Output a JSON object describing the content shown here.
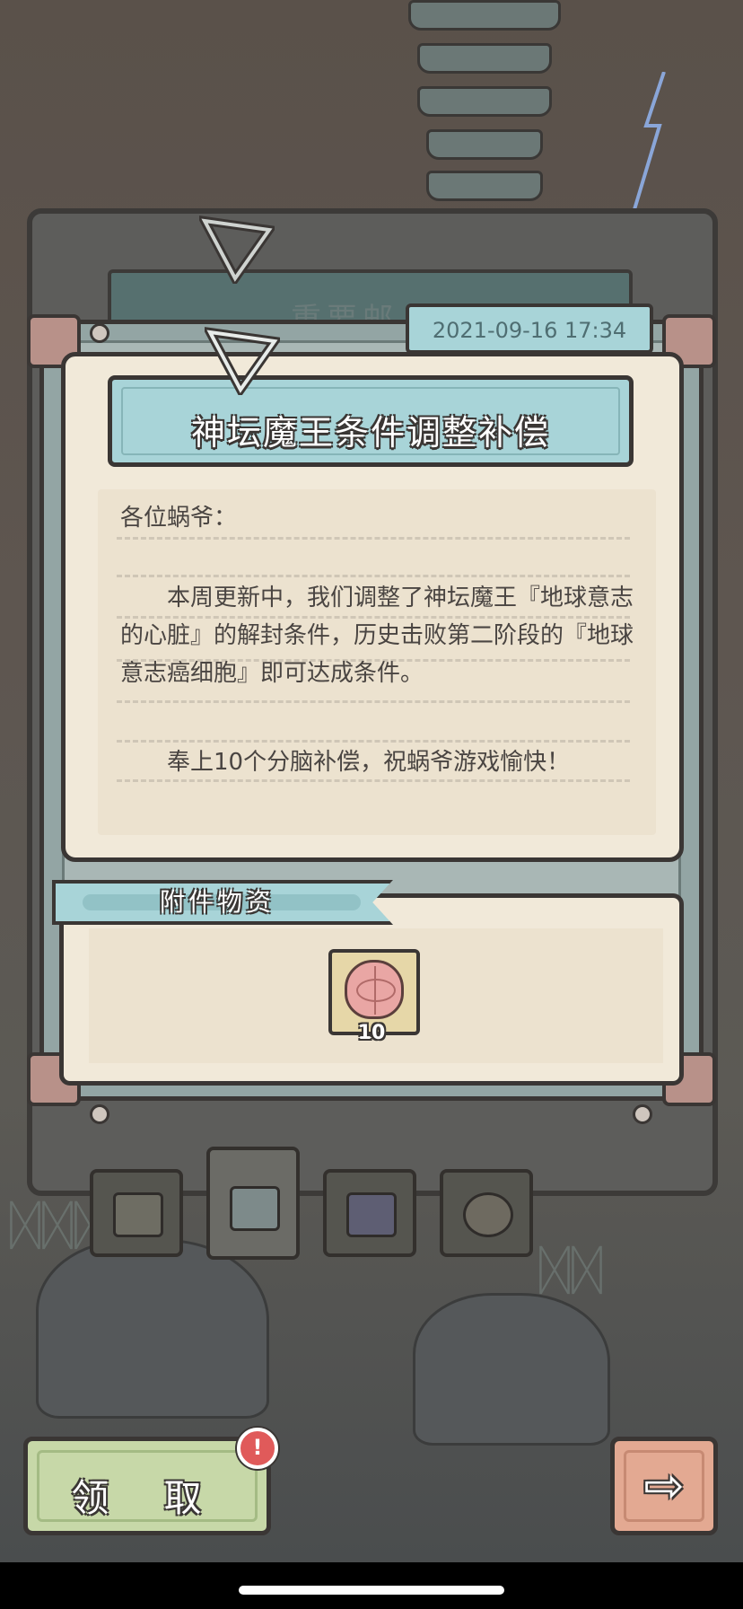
{
  "mail": {
    "ghost_title": "重要邮",
    "date": "2021-09-16  17:34",
    "title": "神坛魔王条件调整补偿",
    "greeting": "各位蜗爷：",
    "paragraph1": "　　本周更新中，我们调整了神坛魔王『地球意志的心脏』的解封条件，历史击败第二阶段的『地球意志癌细胞』即可达成条件。",
    "paragraph2": "　　奉上10个分脑补偿，祝蜗爷游戏愉快！"
  },
  "attachment": {
    "label": "附件物资",
    "items": [
      {
        "icon": "brain-icon",
        "quantity": "10"
      }
    ]
  },
  "tabs": [
    {
      "icon": "envelope-icon",
      "active": false
    },
    {
      "icon": "snail-mail-icon",
      "active": true
    },
    {
      "icon": "signboard-icon",
      "active": false
    },
    {
      "icon": "character-icon",
      "active": false
    }
  ],
  "actions": {
    "claim_label": "领 取",
    "alert_badge": "!",
    "next_label": "⇨"
  },
  "colors": {
    "banner": "#a8d4d8",
    "paper": "#f1e9d9",
    "claim_button": "#c7d8a8",
    "next_button": "#e3a992",
    "alert": "#e05a5a"
  }
}
